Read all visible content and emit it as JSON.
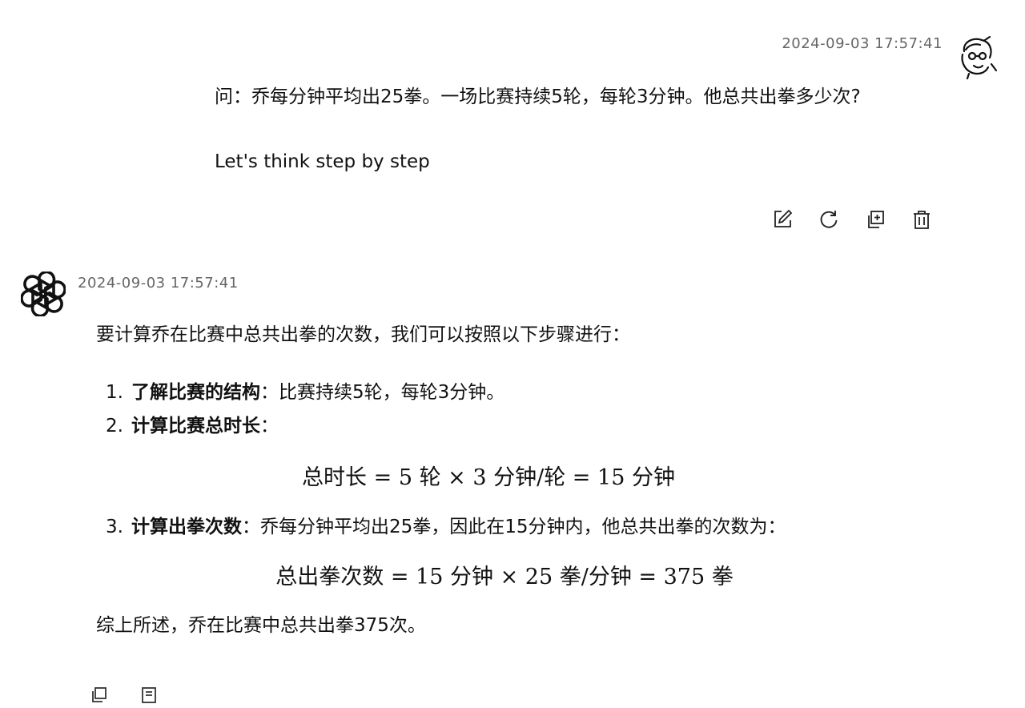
{
  "user_message": {
    "timestamp": "2024-09-03 17:57:41",
    "avatar_icon": "user-avatar-icon",
    "question": "问：乔每分钟平均出25拳。一场比赛持续5轮，每轮3分钟。他总共出拳多少次?",
    "suffix": "Let's think step by step",
    "actions": [
      {
        "name": "edit-icon"
      },
      {
        "name": "regenerate-icon"
      },
      {
        "name": "copy-icon"
      },
      {
        "name": "delete-icon"
      }
    ]
  },
  "assistant_message": {
    "timestamp": "2024-09-03 17:57:41",
    "avatar_icon": "openai-logo-icon",
    "intro": "要计算乔在比赛中总共出拳的次数，我们可以按照以下步骤进行：",
    "steps": [
      {
        "number": "1.",
        "title": "了解比赛的结构",
        "text": "：比赛持续5轮，每轮3分钟。"
      },
      {
        "number": "2.",
        "title": "计算比赛总时长",
        "text": "："
      },
      {
        "number": "3.",
        "title": "计算出拳次数",
        "text": "：乔每分钟平均出25拳，因此在15分钟内，他总共出拳的次数为："
      }
    ],
    "formula_1": "总时长 = 5 轮 × 3 分钟/轮 = 15 分钟",
    "formula_2": "总出拳次数 = 15 分钟 × 25 拳/分钟 = 375 拳",
    "conclusion": "综上所述，乔在比赛中总共出拳375次。",
    "bottom_actions": [
      {
        "name": "copy-icon"
      },
      {
        "name": "more-icon"
      }
    ]
  }
}
